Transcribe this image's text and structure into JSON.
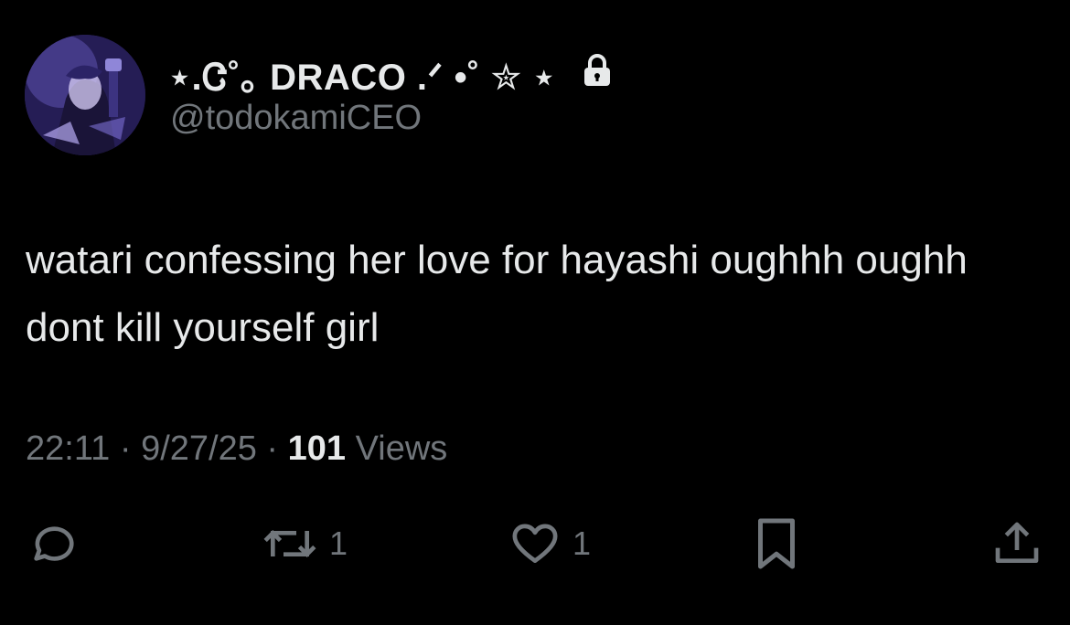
{
  "author": {
    "display_name": "⋆.Ꮳ˚｡ DRACO .ᐟ •˚ ✮ ⋆",
    "handle": "@todokamiCEO",
    "protected_icon": "lock-icon",
    "avatar_icon": "avatar-image"
  },
  "tweet": {
    "text": "watari confessing her love for hayashi oughhh oughh dont kill yourself girl"
  },
  "meta": {
    "time": "22:11",
    "separator1": " · ",
    "date": "9/27/25",
    "separator2": " · ",
    "views_count": "101",
    "views_label": " Views"
  },
  "actions": {
    "reply": {
      "icon": "reply-icon",
      "count": ""
    },
    "retweet": {
      "icon": "retweet-icon",
      "count": "1"
    },
    "like": {
      "icon": "heart-icon",
      "count": "1"
    },
    "bookmark": {
      "icon": "bookmark-icon",
      "count": ""
    },
    "share": {
      "icon": "share-icon",
      "count": ""
    }
  },
  "colors": {
    "background": "#000000",
    "primary_text": "#e7e9ea",
    "secondary_text": "#71767b"
  }
}
